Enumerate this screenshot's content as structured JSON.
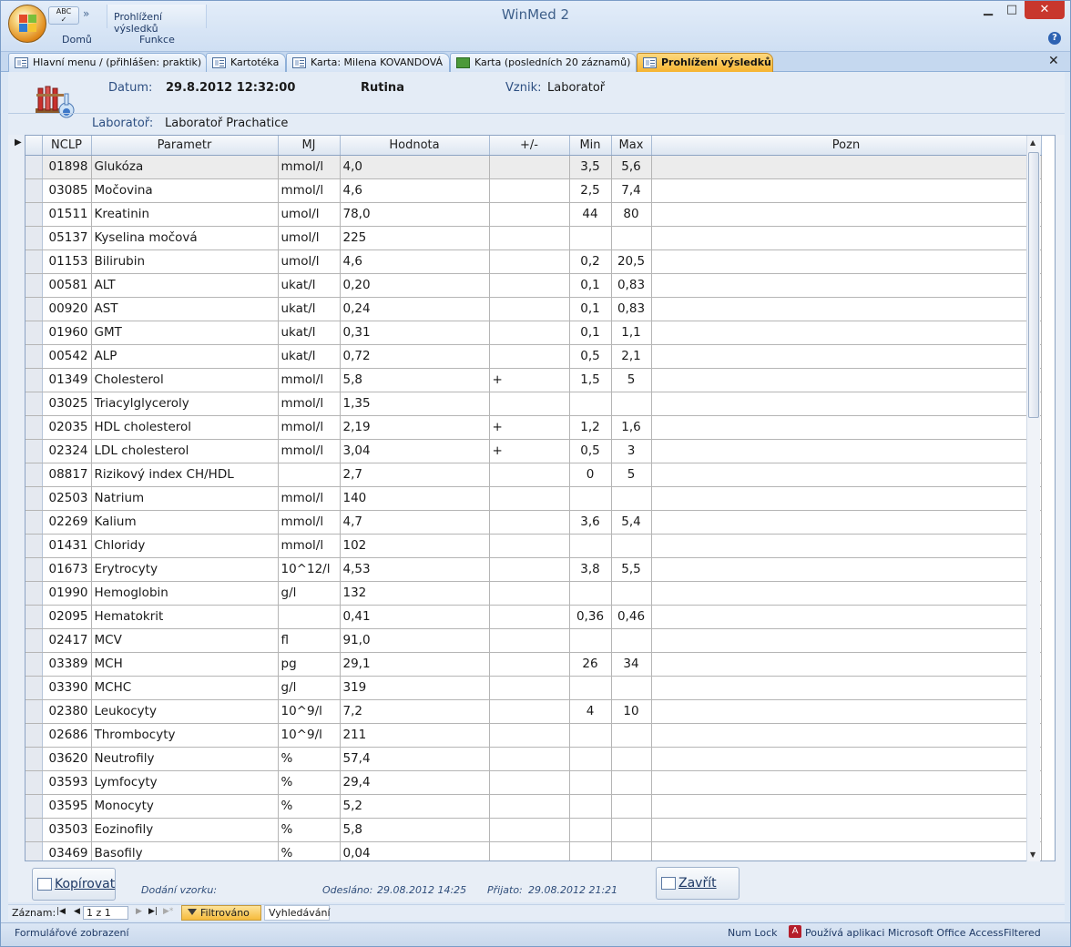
{
  "window": {
    "title": "WinMed 2",
    "qat_label": "ABC",
    "context_tab": "Prohlížení výsledků",
    "ribbon_tabs": [
      "Domů",
      "Funkce"
    ]
  },
  "doc_tabs": [
    {
      "label": "Hlavní menu / (přihlášen: praktik)",
      "active": false,
      "icon": "form-icon"
    },
    {
      "label": "Kartotéka",
      "active": false,
      "icon": "form-icon"
    },
    {
      "label": "Karta: Milena KOVANDOVÁ",
      "active": false,
      "icon": "form-icon"
    },
    {
      "label": "Karta (posledních 20 záznamů)",
      "active": false,
      "icon": "sheet-icon"
    },
    {
      "label": "Prohlížení výsledků",
      "active": true,
      "icon": "form-icon"
    }
  ],
  "header": {
    "date_label": "Datum:",
    "date_value": "29.8.2012 12:32:00",
    "type": "Rutina",
    "origin_label": "Vznik:",
    "origin_value": "Laboratoř",
    "lab_label": "Laboratoř:",
    "lab_value": "Laboratoř Prachatice"
  },
  "grid": {
    "columns": [
      "NCLP",
      "Parametr",
      "MJ",
      "Hodnota",
      "+/-",
      "Min",
      "Max",
      "Pozn"
    ],
    "rows": [
      [
        "01898",
        "Glukóza",
        "mmol/l",
        "4,0",
        "",
        "3,5",
        "5,6",
        ""
      ],
      [
        "03085",
        "Močovina",
        "mmol/l",
        "4,6",
        "",
        "2,5",
        "7,4",
        ""
      ],
      [
        "01511",
        "Kreatinin",
        "umol/l",
        "78,0",
        "",
        "44",
        "80",
        ""
      ],
      [
        "05137",
        "Kyselina močová",
        "umol/l",
        "225",
        "",
        "",
        "",
        ""
      ],
      [
        "01153",
        "Bilirubin",
        "umol/l",
        "4,6",
        "",
        "0,2",
        "20,5",
        ""
      ],
      [
        "00581",
        "ALT",
        "ukat/l",
        "0,20",
        "",
        "0,1",
        "0,83",
        ""
      ],
      [
        "00920",
        "AST",
        "ukat/l",
        "0,24",
        "",
        "0,1",
        "0,83",
        ""
      ],
      [
        "01960",
        "GMT",
        "ukat/l",
        "0,31",
        "",
        "0,1",
        "1,1",
        ""
      ],
      [
        "00542",
        "ALP",
        "ukat/l",
        "0,72",
        "",
        "0,5",
        "2,1",
        ""
      ],
      [
        "01349",
        "Cholesterol",
        "mmol/l",
        "5,8",
        "+",
        "1,5",
        "5",
        ""
      ],
      [
        "03025",
        "Triacylglyceroly",
        "mmol/l",
        "1,35",
        "",
        "",
        "",
        ""
      ],
      [
        "02035",
        "HDL cholesterol",
        "mmol/l",
        "2,19",
        "+",
        "1,2",
        "1,6",
        ""
      ],
      [
        "02324",
        "LDL cholesterol",
        "mmol/l",
        "3,04",
        "+",
        "0,5",
        "3",
        ""
      ],
      [
        "08817",
        "Rizikový index CH/HDL",
        "",
        "2,7",
        "",
        "0",
        "5",
        ""
      ],
      [
        "02503",
        "Natrium",
        "mmol/l",
        "140",
        "",
        "",
        "",
        ""
      ],
      [
        "02269",
        "Kalium",
        "mmol/l",
        "4,7",
        "",
        "3,6",
        "5,4",
        ""
      ],
      [
        "01431",
        "Chloridy",
        "mmol/l",
        "102",
        "",
        "",
        "",
        ""
      ],
      [
        "01673",
        "Erytrocyty",
        "10^12/l",
        "4,53",
        "",
        "3,8",
        "5,5",
        ""
      ],
      [
        "01990",
        "Hemoglobin",
        "g/l",
        "132",
        "",
        "",
        "",
        ""
      ],
      [
        "02095",
        "Hematokrit",
        "",
        "0,41",
        "",
        "0,36",
        "0,46",
        ""
      ],
      [
        "02417",
        "MCV",
        "fl",
        "91,0",
        "",
        "",
        "",
        ""
      ],
      [
        "03389",
        "MCH",
        "pg",
        "29,1",
        "",
        "26",
        "34",
        ""
      ],
      [
        "03390",
        "MCHC",
        "g/l",
        "319",
        "",
        "",
        "",
        ""
      ],
      [
        "02380",
        "Leukocyty",
        "10^9/l",
        "7,2",
        "",
        "4",
        "10",
        ""
      ],
      [
        "02686",
        "Thrombocyty",
        "10^9/l",
        "211",
        "",
        "",
        "",
        ""
      ],
      [
        "03620",
        "Neutrofily",
        "%",
        "57,4",
        "",
        "",
        "",
        ""
      ],
      [
        "03593",
        "Lymfocyty",
        "%",
        "29,4",
        "",
        "",
        "",
        ""
      ],
      [
        "03595",
        "Monocyty",
        "%",
        "5,2",
        "",
        "",
        "",
        ""
      ],
      [
        "03503",
        "Eozinofily",
        "%",
        "5,8",
        "",
        "",
        "",
        ""
      ],
      [
        "03469",
        "Basofily",
        "%",
        "0,04",
        "",
        "",
        "",
        ""
      ]
    ]
  },
  "footer": {
    "copy_button": "Kopírovat",
    "close_button": "Zavřít",
    "delivery_label": "Dodání vzorku:",
    "sent_label": "Odesláno:",
    "sent_value": "29.08.2012 14:25",
    "received_label": "Přijato:",
    "received_value": "29.08.2012 21:21"
  },
  "navigation": {
    "record_label": "Záznam:",
    "record_value": "1 z 1",
    "filter_label": "Filtrováno",
    "search_label": "Vyhledávání"
  },
  "statusbar": {
    "left": "Formulářové zobrazení",
    "numlock": "Num Lock",
    "access": "Používá aplikaci Microsoft Office Access",
    "filtered": "Filtered"
  }
}
